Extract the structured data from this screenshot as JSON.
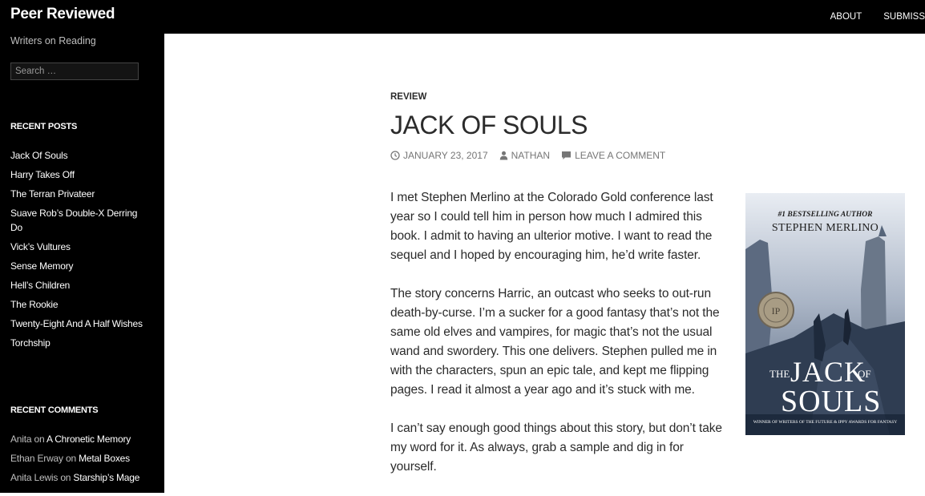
{
  "site": {
    "title": "Peer Reviewed",
    "tagline": "Writers on Reading"
  },
  "nav": {
    "items": [
      "ABOUT",
      "SUBMISS"
    ]
  },
  "search": {
    "placeholder": "Search …"
  },
  "recent_posts": {
    "title": "RECENT POSTS",
    "items": [
      "Jack Of Souls",
      "Harry Takes Off",
      "The Terran Privateer",
      "Suave Rob’s Double-X Derring Do",
      "Vick’s Vultures",
      "Sense Memory",
      "Hell’s Children",
      "The Rookie",
      "Twenty-Eight And A Half Wishes",
      "Torchship"
    ]
  },
  "recent_comments": {
    "title": "RECENT COMMENTS",
    "items": [
      {
        "author": "Anita",
        "on": "on",
        "post": "A Chronetic Memory"
      },
      {
        "author": "Ethan Erway",
        "on": "on",
        "post": "Metal Boxes"
      },
      {
        "author": "Anita Lewis",
        "on": "on",
        "post": "Starship’s Mage"
      }
    ]
  },
  "article": {
    "category": "REVIEW",
    "title": "JACK OF SOULS",
    "date": "JANUARY 23, 2017",
    "author": "NATHAN",
    "comment_link": "LEAVE A COMMENT",
    "paragraphs": [
      "I met Stephen Merlino at the Colorado Gold conference last year so I could tell him in person how much I admired this book. I admit to having an ulterior motive. I want to read the sequel and I hoped by encouraging him, he’d write faster.",
      "The story concerns Harric, an outcast who seeks to out-run death-by-curse. I’m a sucker for a good fantasy that’s not the same old elves and vampires, for magic that’s not the usual wand and swordery. This one delivers. Stephen pulled me in with the characters, spun an epic tale, and kept me flipping pages. I read it almost a year ago and it’s stuck with me.",
      "I can’t say enough good things about this story, but don’t take my word for it. As always, grab a sample and dig in for yourself."
    ],
    "book": {
      "tagline": "#1 BESTSELLING AUTHOR",
      "author": "STEPHEN MERLINO",
      "title_the": "THE",
      "title_jack": "JACK",
      "title_of": "OF",
      "title_souls": "SOULS",
      "award": "WINNER OF WRITERS OF THE FUTURE & IPPY AWARDS FOR FANTASY"
    }
  },
  "colors": {
    "background": "#ffffff",
    "sidebar": "#000000",
    "text": "#2b2b2b",
    "meta": "#767676"
  }
}
